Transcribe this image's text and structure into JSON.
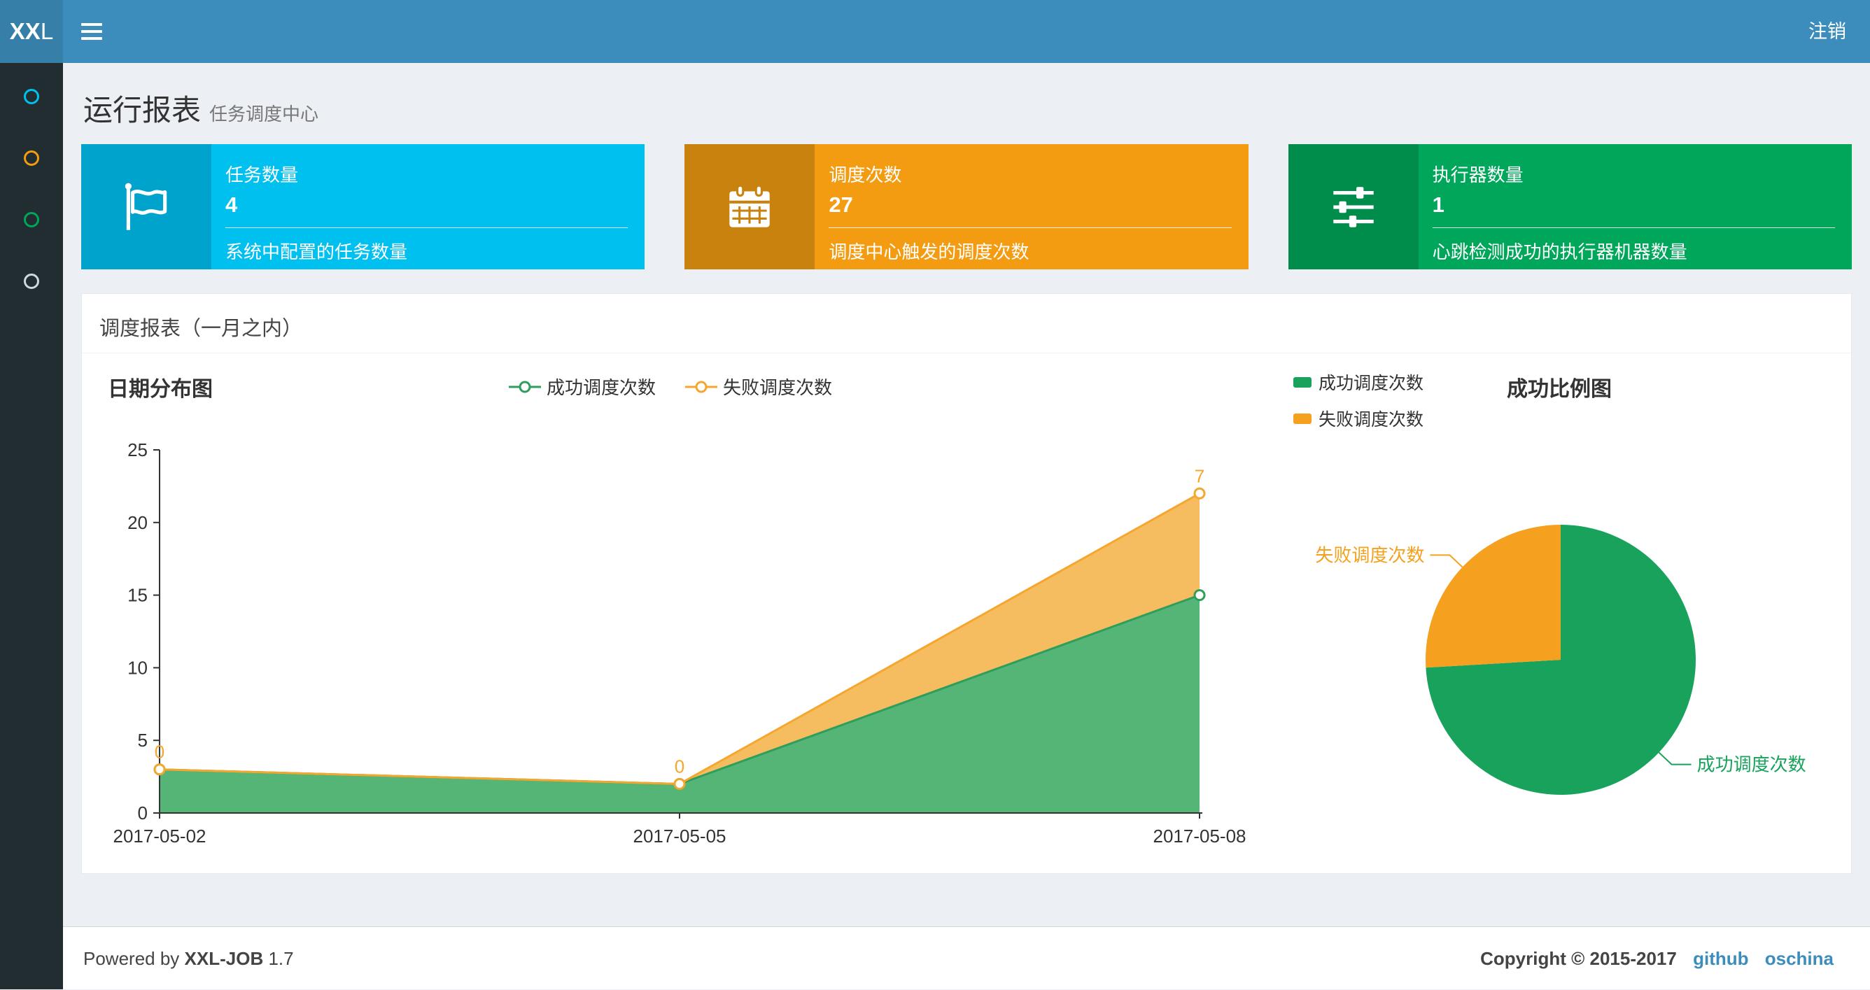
{
  "theme": {
    "navbar_bg": "#3c8dbc",
    "logo_bg": "#367fa9",
    "sidebar_bg": "#222d32",
    "content_bg": "#ecf0f5",
    "link": "#3c8dbc"
  },
  "navbar": {
    "logo_bold": "XX",
    "logo_light": "L",
    "logout": "注销"
  },
  "sidebar": {
    "items": [
      {
        "name": "report",
        "color": "#00c0ef"
      },
      {
        "name": "job-manage",
        "color": "#f39c12"
      },
      {
        "name": "job-log",
        "color": "#00a65a"
      },
      {
        "name": "executor",
        "color": "#d2d6de"
      }
    ]
  },
  "page_header": {
    "title": "运行报表",
    "subtitle": "任务调度中心"
  },
  "info_boxes": [
    {
      "title": "任务数量",
      "value": "4",
      "desc": "系统中配置的任务数量",
      "bg": "#00c0ef",
      "icon_bg": "#00a3cb",
      "icon": "flag-icon"
    },
    {
      "title": "调度次数",
      "value": "27",
      "desc": "调度中心触发的调度次数",
      "bg": "#f39c12",
      "icon_bg": "#c9820e",
      "icon": "calendar-icon"
    },
    {
      "title": "执行器数量",
      "value": "1",
      "desc": "心跳检测成功的执行器机器数量",
      "bg": "#00a65a",
      "icon_bg": "#008d4c",
      "icon": "sliders-icon"
    }
  ],
  "panel": {
    "title": "调度报表（一月之内）"
  },
  "chart_data": [
    {
      "type": "area",
      "title": "日期分布图",
      "x": [
        "2017-05-02",
        "2017-05-05",
        "2017-05-08"
      ],
      "series": [
        {
          "name": "成功调度次数",
          "values": [
            3,
            2,
            15
          ],
          "color": "#2f9e5c",
          "fill": "#55b577"
        },
        {
          "name": "失败调度次数",
          "values": [
            0,
            0,
            7
          ],
          "color": "#f5a62e",
          "fill": "#f6bd60",
          "labels": [
            "0",
            "0",
            "7"
          ]
        }
      ],
      "stacked": true,
      "ylim": [
        0,
        25
      ],
      "yticks": [
        0,
        5,
        10,
        15,
        20,
        25
      ],
      "grid": false,
      "legend_position": "top-center"
    },
    {
      "type": "pie",
      "title": "成功比例图",
      "slices": [
        {
          "name": "成功调度次数",
          "value": 20,
          "color": "#19a25c"
        },
        {
          "name": "失败调度次数",
          "value": 7,
          "color": "#f5a11f"
        }
      ],
      "legend_position": "top-left"
    }
  ],
  "footer": {
    "powered_by": "Powered by",
    "product": "XXL-JOB",
    "version": "1.7",
    "copyright": "Copyright © 2015-2017",
    "links": [
      "github",
      "oschina"
    ]
  }
}
